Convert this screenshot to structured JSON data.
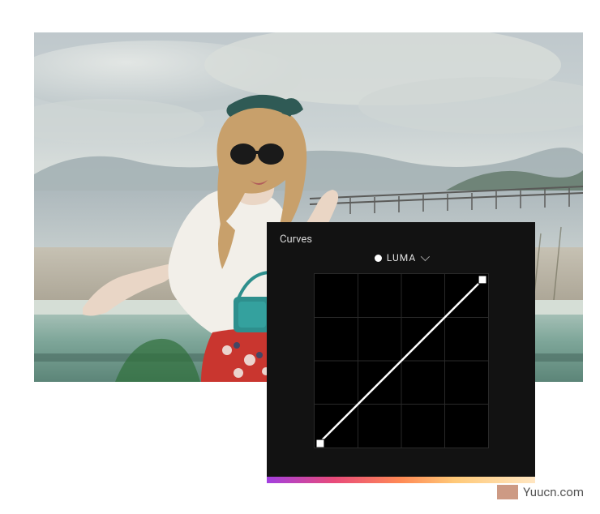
{
  "panel": {
    "title": "Curves",
    "channel": {
      "label": "LUMA",
      "color": "#ffffff"
    }
  },
  "chart_data": {
    "type": "line",
    "title": "Curves",
    "xlabel": "",
    "ylabel": "",
    "xlim": [
      0,
      1
    ],
    "ylim": [
      0,
      1
    ],
    "grid": true,
    "series": [
      {
        "name": "LUMA",
        "x": [
          0,
          1
        ],
        "y": [
          0,
          1
        ]
      }
    ],
    "control_points": [
      {
        "x": 0,
        "y": 0
      },
      {
        "x": 1,
        "y": 1
      }
    ]
  },
  "watermark": {
    "text": "Yuucn.com"
  }
}
